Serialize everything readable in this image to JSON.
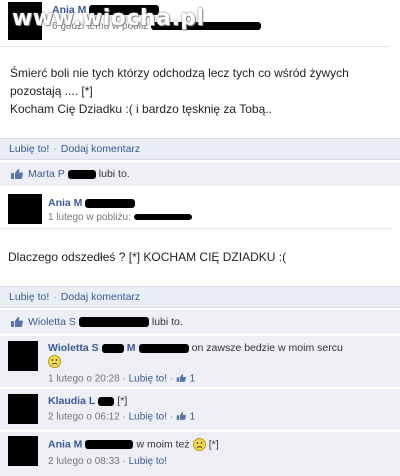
{
  "watermark": "www.wiocha.pl",
  "post1": {
    "author_name": "Ania M",
    "meta": "6 godzi temu w pobliz",
    "text_line1": "Śmierć boli nie tych którzy odchodzą lecz tych co wśród żywych",
    "text_line2": "pozostają .... [*]",
    "text_line3": "Kocham Cię Dziadku :( i bardzo tęsknię za Tobą..",
    "like_label": "Lubię to!",
    "comment_label": "Dodaj komentarz",
    "sep": "·",
    "likes_name": "Marta P",
    "likes_suffix": "lubi to."
  },
  "post2": {
    "author_name": "Ania M",
    "meta": "1 lutego w pobliżu:",
    "text": "Dlaczego odszedłeś ? [*] KOCHAM CIĘ DZIADKU :(",
    "like_label": "Lubię to!",
    "comment_label": "Dodaj komentarz",
    "sep": "·",
    "likes_name": "Wioletta S",
    "likes_suffix": "lubi to."
  },
  "comments": [
    {
      "name": "Wioletta S",
      "name_tail": "M",
      "text": "on zawsze bedzie w moim sercu",
      "date": "1 lutego o 20:28",
      "like": "Lubię to!",
      "likes": "1"
    },
    {
      "name": "Klaudia L",
      "text": "[*]",
      "date": "2 lutego o 06:12",
      "like": "Lubię to!",
      "likes": "1"
    },
    {
      "name": "Ania M",
      "text": "w moim też",
      "text_tail": "[*]",
      "date": "2 lutego o 08:33",
      "like": "Lubię to!"
    }
  ],
  "colors": {
    "link": "#3b5998",
    "like_bar": "#e9edf4",
    "comment_bg": "#edeff4"
  },
  "icons": [
    "thumbs-up-icon",
    "smiley-icon"
  ]
}
